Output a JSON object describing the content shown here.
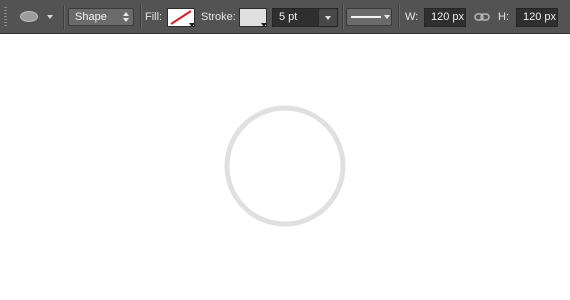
{
  "toolbar": {
    "tool_preset": {
      "icon": "ellipse-tool-icon"
    },
    "mode_select": {
      "value": "Shape"
    },
    "fill": {
      "label": "Fill:",
      "swatch": "none",
      "slash_color": "#d21f2a"
    },
    "stroke": {
      "label": "Stroke:",
      "swatch_color": "#e0e0e0",
      "width": "5 pt",
      "style_icon": "line-style-icon"
    },
    "width": {
      "label": "W:",
      "value": "120 px"
    },
    "link_icon": "link-icon",
    "height": {
      "label": "H:",
      "value": "120 px"
    },
    "colors": {
      "toolbar_bg": "#535353",
      "field_bg": "#2f2f2f",
      "text": "#e4e4e4"
    }
  },
  "canvas": {
    "background": "#ffffff",
    "shape": {
      "type": "ellipse",
      "stroke_color": "#e0e0e0",
      "stroke": "5 pt",
      "width": "120 px",
      "height": "120 px"
    }
  }
}
